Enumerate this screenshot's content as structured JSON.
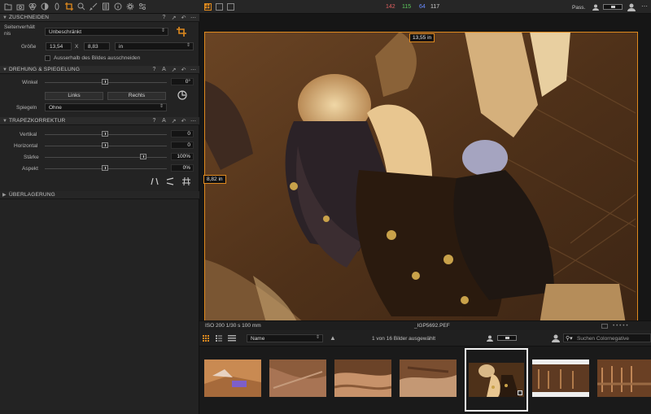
{
  "toolbar": {
    "tools": [
      "folder-icon",
      "camera-icon",
      "color-circles-icon",
      "exposure-icon",
      "lens-icon",
      "crop-icon",
      "search-icon",
      "brush-icon",
      "metadata-icon",
      "info-icon",
      "gear-icon",
      "adjustments-icon"
    ],
    "active_tool": "crop-icon"
  },
  "crop": {
    "title": "ZUSCHNEIDEN",
    "ratio_label": "Seitenverhält\nnis",
    "ratio_value": "Unbeschränkt",
    "size_label": "Größe",
    "width": "13,54",
    "x_sep": "X",
    "height": "8,83",
    "unit": "in",
    "outside_label": "Ausserhalb des Bildes ausschneiden"
  },
  "rotation": {
    "title": "DREHUNG & SPIEGELUNG",
    "angle_label": "Winkel",
    "angle_value": "0°",
    "left_button": "Links",
    "right_button": "Rechts",
    "mirror_label": "Spiegeln",
    "mirror_value": "Ohne"
  },
  "keystone": {
    "title": "TRAPEZKORREKTUR",
    "vertical_label": "Vertikal",
    "vertical_value": "0",
    "horizontal_label": "Horizontal",
    "horizontal_value": "0",
    "amount_label": "Stärke",
    "amount_value": "100%",
    "aspect_label": "Aspekt",
    "aspect_value": "0%"
  },
  "overlay": {
    "title": "ÜBERLAGERUNG"
  },
  "readout": {
    "r": "142",
    "g": "115",
    "b": "64",
    "l": "117"
  },
  "top_right": {
    "pass": "Pass."
  },
  "viewer": {
    "width_tag": "13,55 in",
    "height_tag": "8,82 in",
    "exif": "ISO 200  1/30 s  100 mm",
    "filename": "_IGP5692.PEF"
  },
  "browser": {
    "sort_value": "Name",
    "count": "1 von 16 Bilder ausgewählt",
    "search_placeholder": "Suchen Colornegative"
  },
  "colors": {
    "accent": "#e08a1e",
    "panel": "#232323",
    "background": "#1b1b1b"
  }
}
